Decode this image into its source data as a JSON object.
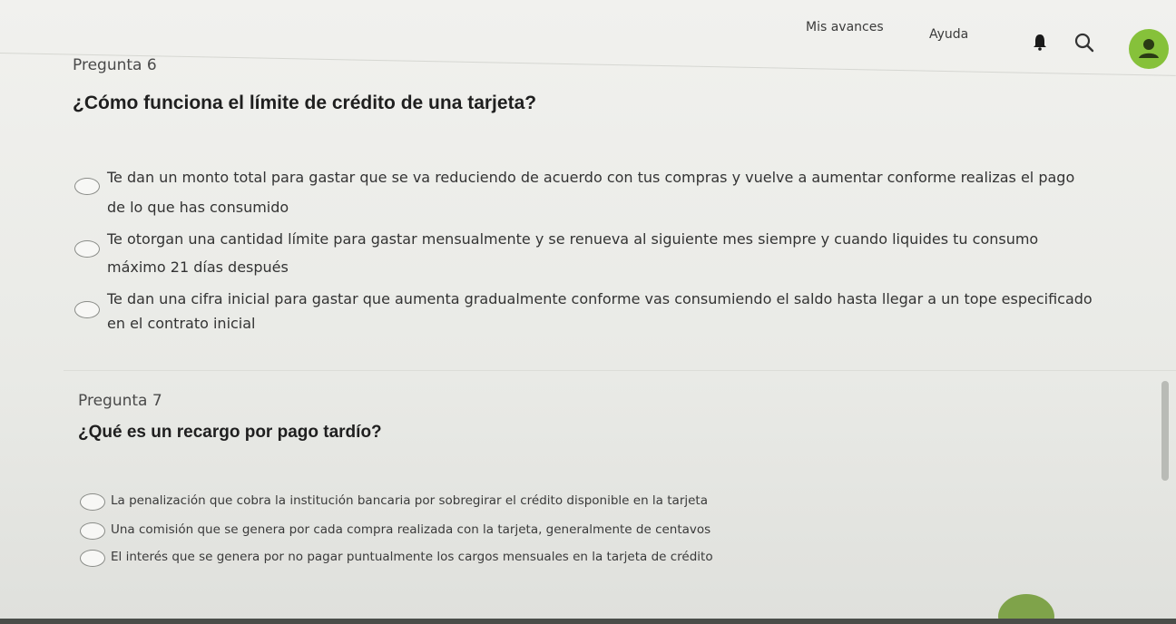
{
  "nav": {
    "avances": "Mis avances",
    "ayuda": "Ayuda",
    "icons": [
      "bell-icon",
      "search-icon",
      "user-avatar-icon"
    ],
    "avatar_color": "#86c13a"
  },
  "q6": {
    "label": "Pregunta 6",
    "text": "¿Cómo funciona el límite de crédito de una tarjeta?",
    "options": [
      {
        "line1": "Te dan un monto total para gastar que se va reduciendo de acuerdo con tus compras y vuelve a aumentar conforme realizas el pago",
        "line2": "de lo que has consumido"
      },
      {
        "line1": "Te otorgan una cantidad límite para gastar mensualmente y se renueva al siguiente mes siempre y cuando liquides tu consumo",
        "line2": "máximo 21 días después"
      },
      {
        "line1": "Te dan una cifra inicial para gastar que aumenta gradualmente conforme vas consumiendo el saldo hasta llegar a un tope especificado",
        "line2": "en el contrato inicial"
      }
    ]
  },
  "q7": {
    "label": "Pregunta 7",
    "text": "¿Qué es un recargo por pago tardío?",
    "options": [
      "La penalización que cobra la institución bancaria por sobregirar el crédito disponible en la tarjeta",
      "Una comisión que se genera por cada compra realizada con la tarjeta, generalmente de centavos",
      "El interés que se genera por no pagar puntualmente los cargos mensuales en la tarjeta de crédito"
    ]
  }
}
